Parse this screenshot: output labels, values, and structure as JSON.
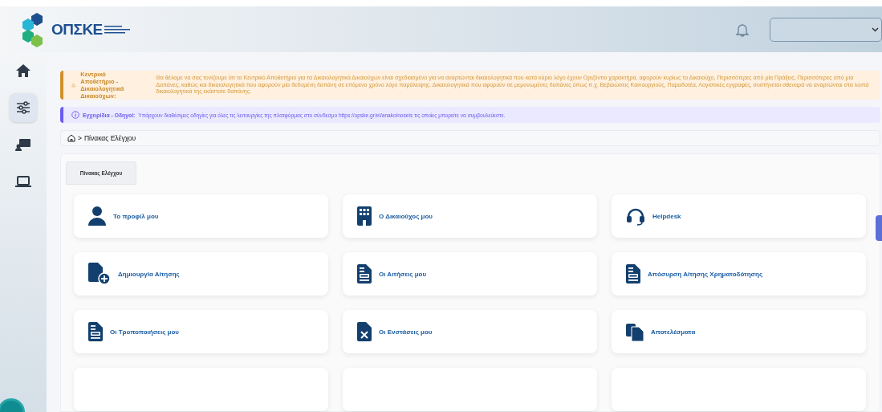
{
  "header": {
    "logo": "ΟΠΣΚΕ"
  },
  "sidebar": {
    "items": [
      {
        "selected": false
      },
      {
        "selected": true
      },
      {
        "selected": false
      },
      {
        "selected": false
      }
    ]
  },
  "alerts": [
    {
      "kind": "warning",
      "title": "Κεντρικό Αποθετήριο - Δικαιολογητικά Δικαιούχων:",
      "text": "Θα θέλαμε να σας τονίζουμε ότι το Κεντρικό Αποθετήριο για τα Δικαιολογητικά Δικαιούχων είναι σχεδιασμένο για να αναρτώνται δικαιολογητικά που κατά κύριο λόγο έχουν Οριζόντιο χαρακτήρα, αφορούν κυρίως το Δικαιούχο, Περισσότερες από μία Πράξεις, Περισσότερες από μία Δαπάνες, καθώς και δικαιολογητικά που αφορούν μία δεδομένη δαπάνη σε επόμενο χρόνο λόγο παράλειψης. Δικαιολογητικά που αφορούν σε μεμονωμένες δαπάνες όπως π.χ. Βεβαιώσεις Καινουργιούς, Παραδοτέα, Λογιστικές εγγραφές, συστήνεται σθεναρά να αναρτώνται στα λοιπά δικαιολογητικά της εκάστοτε δαπάνης."
    },
    {
      "kind": "info",
      "title": "Εγχειρίδια - Οδηγοί:",
      "text": "Υπάρχουν διαθέσιμες οδηγίες για όλες τις λειτουργίες της πλατφόρμας στο σύνδεσμο https://opske.gr/el/anakoinoseis τις οποίες μπορείτε να συμβουλεύεστε."
    }
  ],
  "breadcrumb": {
    "separator": ">",
    "current": "Πίνακας Ελέγχου"
  },
  "tabs": [
    {
      "label": "Πίνακας Ελέγχου",
      "selected": true
    }
  ],
  "cards": [
    {
      "kind": "person",
      "label": "Το προφίλ μου"
    },
    {
      "kind": "building",
      "label": "Ο Δικαιούχος μου"
    },
    {
      "kind": "headset",
      "label": "Helpdesk"
    },
    {
      "kind": "fileplus",
      "label": "Δημιουργία Αίτησης"
    },
    {
      "kind": "form",
      "label": "Οι Αιτήσεις μου"
    },
    {
      "kind": "form",
      "label": "Απόσυρση Αίτησης Χρηματοδότησης"
    },
    {
      "kind": "form",
      "label": "Οι Τροποποιήσεις μου"
    },
    {
      "kind": "filex",
      "label": "Οι Ενστάσεις μου"
    },
    {
      "kind": "files",
      "label": "Αποτελέσματα"
    },
    {
      "kind": "blank"
    },
    {
      "kind": "blank"
    },
    {
      "kind": "blank"
    }
  ]
}
